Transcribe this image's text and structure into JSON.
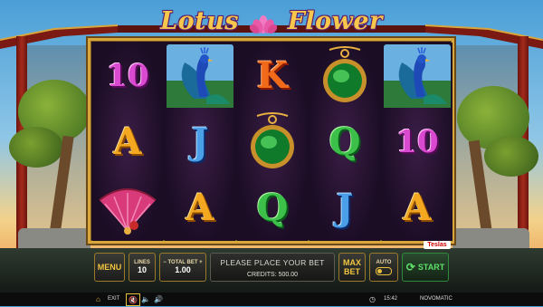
{
  "game": {
    "title_left": "Lotus",
    "title_right": "Flower"
  },
  "reels": [
    [
      "10",
      "A",
      "fan"
    ],
    [
      "peacock",
      "J",
      "A"
    ],
    [
      "K",
      "emerald-pendant",
      "Q"
    ],
    [
      "emerald-pendant",
      "Q",
      "J"
    ],
    [
      "peacock",
      "10",
      "A"
    ]
  ],
  "provider_badge": "Teslas",
  "controls": {
    "menu": "MENU",
    "lines_label": "LINES",
    "lines_value": "10",
    "total_bet_label": "TOTAL BET",
    "total_bet_value": "1.00",
    "message": "PLEASE PLACE YOUR BET",
    "credits": "CREDITS: 500.00",
    "max_bet_line1": "MAX",
    "max_bet_line2": "BET",
    "auto": "AUTO",
    "start": "START"
  },
  "bottom_bar": {
    "exit": "EXIT",
    "time": "15:42",
    "brand": "NOVOMATIC"
  },
  "colors": {
    "gold": "#d9a63c",
    "green": "#5ee06a"
  }
}
